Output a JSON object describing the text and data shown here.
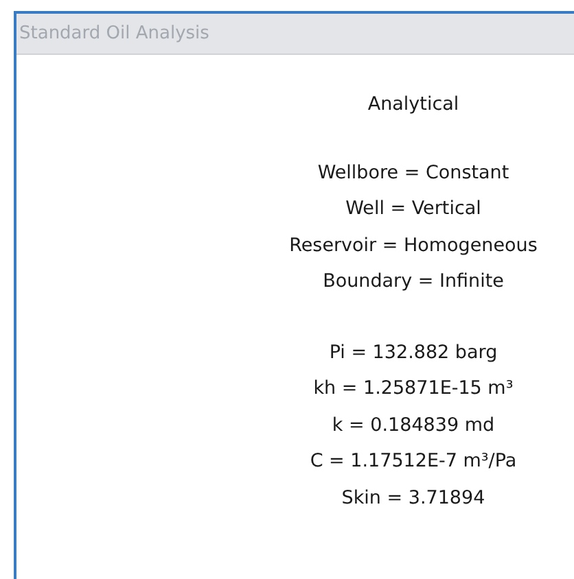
{
  "window": {
    "title": "Standard Oil Analysis"
  },
  "heading": "Analytical",
  "model": [
    "Wellbore = Constant",
    "Well = Vertical",
    "Reservoir = Homogeneous",
    "Boundary = Infinite"
  ],
  "results": [
    "Pi = 132.882 barg",
    "kh = 1.25871E-15 m³",
    "k = 0.184839 md",
    "C = 1.17512E-7 m³/Pa",
    "Skin = 3.71894"
  ]
}
